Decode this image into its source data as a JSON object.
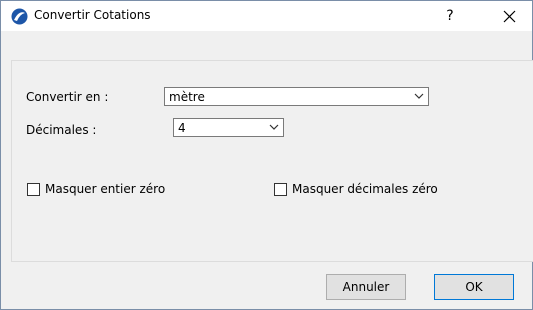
{
  "window": {
    "title": "Convertir Cotations",
    "help_label": "?",
    "close_label": "✕",
    "icon": "archicad-app-icon"
  },
  "form": {
    "convert_label": "Convertir en :",
    "convert_value": "mètre",
    "decimals_label": "Décimales :",
    "decimals_value": "4",
    "hide_zero_integer_label": "Masquer entier zéro",
    "hide_zero_integer_checked": false,
    "hide_zero_decimals_label": "Masquer décimales zéro",
    "hide_zero_decimals_checked": false
  },
  "buttons": {
    "cancel_label": "Annuler",
    "ok_label": "OK"
  },
  "colors": {
    "titlebar": "#ffffff",
    "dialog_bg": "#f0f0f0",
    "accent": "#0078d7"
  }
}
